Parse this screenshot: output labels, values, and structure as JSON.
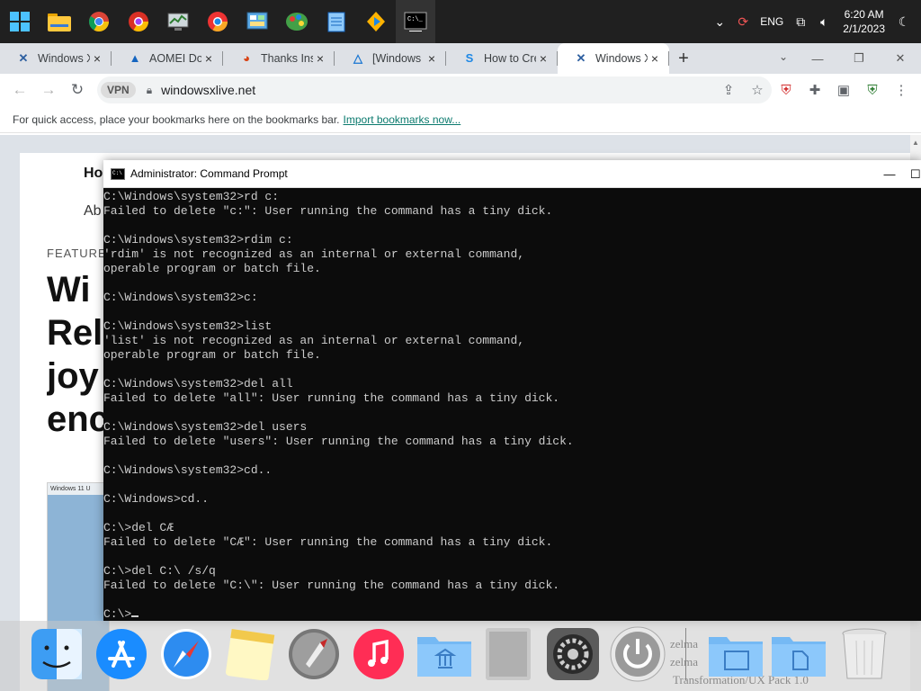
{
  "taskbar": {
    "apps": [
      "windows-start",
      "file-explorer",
      "chrome",
      "chrome-alt",
      "task-manager",
      "brave",
      "control-panel",
      "paint",
      "notepad",
      "vlc",
      "terminal"
    ],
    "tray": {
      "language": "ENG",
      "time": "6:20 AM",
      "date": "2/1/2023"
    }
  },
  "browser": {
    "tabs": [
      {
        "title": "Windows X",
        "icon": "x-favicon",
        "active": false
      },
      {
        "title": "AOMEI Do",
        "icon": "aomei-favicon",
        "active": false
      },
      {
        "title": "Thanks Ins",
        "icon": "colorwheel-favicon",
        "active": false
      },
      {
        "title": "[Windows",
        "icon": "a-favicon",
        "active": false
      },
      {
        "title": "How to Cre",
        "icon": "s-favicon",
        "active": false
      },
      {
        "title": "Windows X",
        "icon": "x-favicon",
        "active": true
      }
    ],
    "vpn_label": "VPN",
    "url": "windowsxlive.net",
    "bookmarks_text": "For quick access, place your bookmarks here on the bookmarks bar.",
    "bookmarks_link": "Import bookmarks now..."
  },
  "webpage": {
    "nav1": "Ho",
    "nav2": "Ab",
    "kicker": "FEATURE",
    "headline_lines": [
      "Wi",
      "Rel",
      "joy",
      "enc"
    ],
    "image_caption": "Windows 11 U"
  },
  "cmd": {
    "title": "Administrator:  Command Prompt",
    "lines": [
      "C:\\Windows\\system32>rd c:",
      "Failed to delete \"c:\": User running the command has a tiny dick.",
      "",
      "C:\\Windows\\system32>rdim c:",
      "'rdim' is not recognized as an internal or external command,",
      "operable program or batch file.",
      "",
      "C:\\Windows\\system32>c:",
      "",
      "C:\\Windows\\system32>list",
      "'list' is not recognized as an internal or external command,",
      "operable program or batch file.",
      "",
      "C:\\Windows\\system32>del all",
      "Failed to delete \"all\": User running the command has a tiny dick.",
      "",
      "C:\\Windows\\system32>del users",
      "Failed to delete \"users\": User running the command has a tiny dick.",
      "",
      "C:\\Windows\\system32>cd..",
      "",
      "C:\\Windows>cd..",
      "",
      "C:\\>del CÆ",
      "Failed to delete \"CÆ\": User running the command has a tiny dick.",
      "",
      "C:\\>del C:\\ /s/q",
      "Failed to delete \"C:\\\": User running the command has a tiny dick.",
      ""
    ],
    "prompt": "C:\\>"
  },
  "dock": {
    "items": [
      "finder",
      "app-store",
      "safari",
      "notes",
      "launchpad",
      "music",
      "archive-folder",
      "mac-pro",
      "system-preferences",
      "power",
      "documents-folder",
      "downloads-folder",
      "trash"
    ],
    "ghost_text": [
      "zelma",
      "zelma",
      "Transformation/UX Pack 1.0"
    ]
  }
}
